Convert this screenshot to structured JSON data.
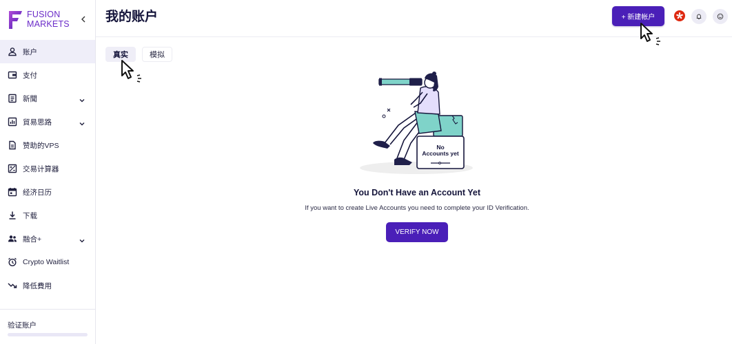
{
  "brand": {
    "line1": "FUSION",
    "line2": "MARKETS",
    "accent": "#6a2bc8",
    "primary_button": "#4a1fb8"
  },
  "sidebar": {
    "items": [
      {
        "label": "账户",
        "icon": "person-icon",
        "active": true,
        "expandable": false
      },
      {
        "label": "支付",
        "icon": "wallet-icon",
        "active": false,
        "expandable": false
      },
      {
        "label": "新聞",
        "icon": "news-icon",
        "active": false,
        "expandable": true
      },
      {
        "label": "貿易思路",
        "icon": "chart-icon",
        "active": false,
        "expandable": true
      },
      {
        "label": "赞助的VPS",
        "icon": "document-icon",
        "active": false,
        "expandable": false
      },
      {
        "label": "交易计算器",
        "icon": "calculator-icon",
        "active": false,
        "expandable": false
      },
      {
        "label": "经济日历",
        "icon": "calendar-icon",
        "active": false,
        "expandable": false
      },
      {
        "label": "下载",
        "icon": "download-icon",
        "active": false,
        "expandable": false
      },
      {
        "label": "融合+",
        "icon": "group-icon",
        "active": false,
        "expandable": true
      },
      {
        "label": "Crypto Waitlist",
        "icon": "alarm-clock-icon",
        "active": false,
        "expandable": false
      },
      {
        "label": "降低費用",
        "icon": "trending-down-icon",
        "active": false,
        "expandable": false
      }
    ],
    "verify_label": "验证账户"
  },
  "header": {
    "title": "我的账户",
    "new_account_button": "+ 新建帐户",
    "flag_icon": "hong-kong-flag-icon",
    "notification_icon": "bell-icon",
    "profile_icon": "smiley-icon"
  },
  "tabs": [
    {
      "label": "真实",
      "active": true
    },
    {
      "label": "模拟",
      "active": false
    }
  ],
  "empty_state": {
    "sign_line1": "No",
    "sign_line2": "Accounts yet",
    "title": "You Don't Have an Account Yet",
    "description": "If you want to create Live Accounts you need to complete your ID Verification.",
    "button": "VERIFY NOW"
  }
}
